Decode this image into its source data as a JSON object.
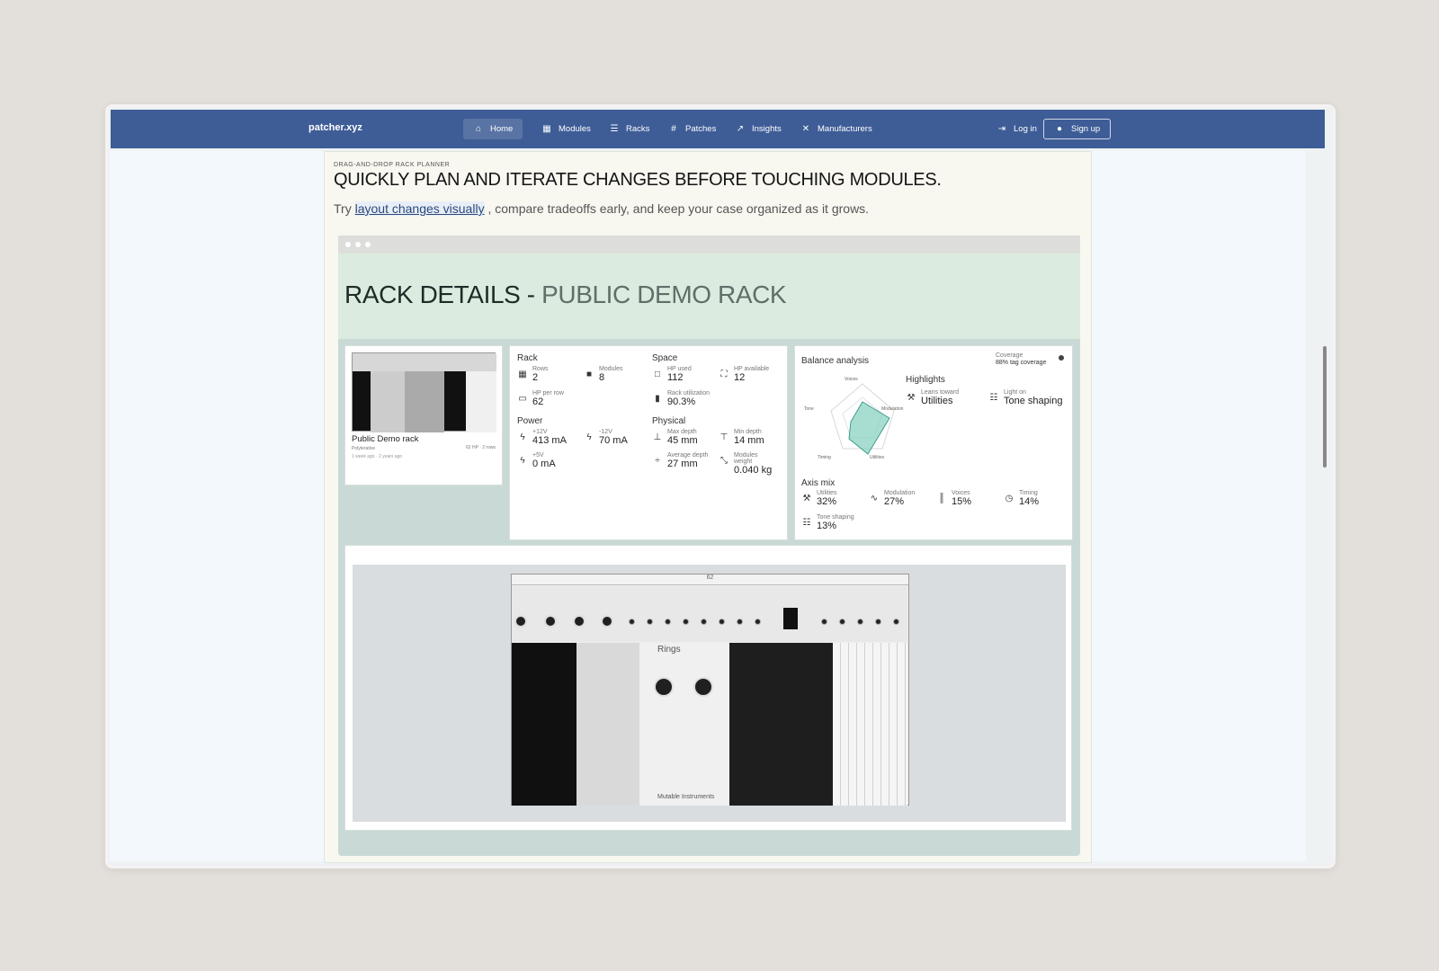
{
  "brand": "patcher.xyz",
  "nav": [
    {
      "label": "Home",
      "icon": "home-icon"
    },
    {
      "label": "Modules",
      "icon": "grid-icon"
    },
    {
      "label": "Racks",
      "icon": "rack-icon"
    },
    {
      "label": "Patches",
      "icon": "patch-icon"
    },
    {
      "label": "Insights",
      "icon": "insights-icon"
    },
    {
      "label": "Manufacturers",
      "icon": "tools-icon"
    }
  ],
  "auth": {
    "login": "Log in",
    "signup": "Sign up"
  },
  "hero": {
    "eyebrow": "DRAG-AND-DROP RACK PLANNER",
    "title": "QUICKLY PLAN AND ITERATE CHANGES BEFORE TOUCHING MODULES.",
    "sub_before": "Try ",
    "sub_link": "layout changes visually",
    "sub_after": " , compare tradeoffs early, and keep your case organized as it grows."
  },
  "mockup": {
    "title_main": "RACK DETAILS - ",
    "title_accent": "PUBLIC DEMO RACK",
    "rack_card": {
      "name": "Public Demo rack",
      "owner": "Polyterative",
      "size": "62 HP · 2 rows",
      "time": "1 week ago · 2 years ago"
    },
    "stats": {
      "rack_heading": "Rack",
      "space_heading": "Space",
      "power_heading": "Power",
      "physical_heading": "Physical",
      "rows": {
        "label": "Rows",
        "value": "2"
      },
      "modules": {
        "label": "Modules",
        "value": "8"
      },
      "hp_used": {
        "label": "HP used",
        "value": "112"
      },
      "hp_available": {
        "label": "HP available",
        "value": "12"
      },
      "hp_per_row": {
        "label": "HP per row",
        "value": "62"
      },
      "rack_utilization": {
        "label": "Rack utilization",
        "value": "90.3%"
      },
      "p12": {
        "label": "+12V",
        "value": "413 mA"
      },
      "m12": {
        "label": "-12V",
        "value": "70 mA"
      },
      "p5": {
        "label": "+5V",
        "value": "0 mA"
      },
      "max_depth": {
        "label": "Max depth",
        "value": "45 mm"
      },
      "min_depth": {
        "label": "Min depth",
        "value": "14 mm"
      },
      "avg_depth": {
        "label": "Average depth",
        "value": "27 mm"
      },
      "weight": {
        "label": "Modules weight",
        "value": "0.040 kg"
      }
    },
    "balance": {
      "heading": "Balance analysis",
      "coverage_label": "Coverage",
      "coverage_value": "88% tag coverage",
      "highlights_heading": "Highlights",
      "leans_label": "Leans toward",
      "leans_value": "Utilities",
      "light_label": "Light on",
      "light_value": "Tone shaping",
      "radar_labels": [
        "Voices",
        "Modulation",
        "Utilities",
        "Timing",
        "Tone"
      ],
      "axis_heading": "Axis mix",
      "axis": [
        {
          "label": "Utilities",
          "value": "32%",
          "icon": "wrench-icon"
        },
        {
          "label": "Modulation",
          "value": "27%",
          "icon": "wave-icon"
        },
        {
          "label": "Voices",
          "value": "15%",
          "icon": "bars-icon"
        },
        {
          "label": "Timing",
          "value": "14%",
          "icon": "timer-icon"
        },
        {
          "label": "Tone shaping",
          "value": "13%",
          "icon": "sliders-icon"
        }
      ]
    },
    "rack_preview": {
      "hp_label": "62",
      "module_names": [
        "Rings"
      ],
      "brand": "Mutable Instruments"
    }
  }
}
